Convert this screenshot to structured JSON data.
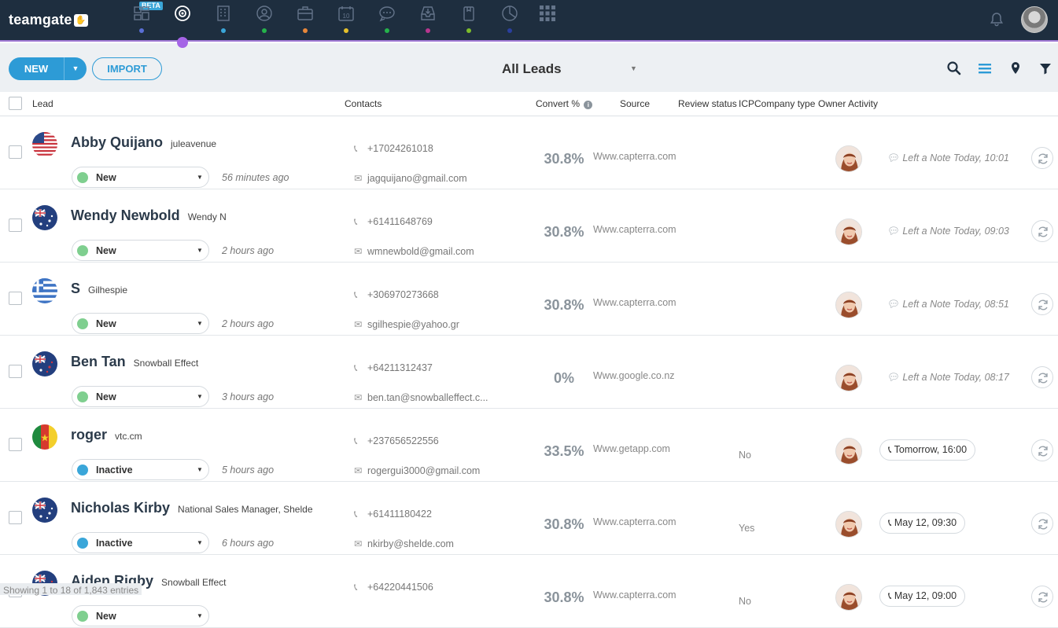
{
  "app": {
    "logo_text": "teamgate",
    "beta_label": "BETA",
    "nav_icons": [
      {
        "name": "dashboard-icon",
        "dot": "#5a6fd6"
      },
      {
        "name": "target-icon",
        "dot": ""
      },
      {
        "name": "building-icon",
        "dot": "#3aa6d9"
      },
      {
        "name": "contacts-icon",
        "dot": "#25b34b"
      },
      {
        "name": "briefcase-icon",
        "dot": "#e8873a"
      },
      {
        "name": "calendar-icon",
        "dot": "#e6c02b"
      },
      {
        "name": "chat-icon",
        "dot": "#25b34b"
      },
      {
        "name": "inbox-icon",
        "dot": "#b8368f"
      },
      {
        "name": "clipboard-icon",
        "dot": "#7dbd2b"
      },
      {
        "name": "pie-chart-icon",
        "dot": "#2a3f9e"
      },
      {
        "name": "apps-grid-icon",
        "dot": ""
      }
    ]
  },
  "toolbar": {
    "new_label": "NEW",
    "import_label": "IMPORT",
    "view_label": "All Leads"
  },
  "columns": {
    "lead": "Lead",
    "contacts": "Contacts",
    "convert": "Convert %",
    "source": "Source",
    "review_status": "Review status",
    "icp": "ICP",
    "company_type": "Company type",
    "owner": "Owner",
    "activity": "Activity"
  },
  "rows": [
    {
      "name": "Abby Quijano",
      "company": "juleavenue",
      "flag": "us",
      "status": "New",
      "status_color": "#7fcf8f",
      "time": "56 minutes ago",
      "phone": "+17024261018",
      "email": "jagquijano@gmail.com",
      "convert": "30.8%",
      "source": "Www.capterra.com",
      "icp": "",
      "activity_type": "note",
      "activity": "Left a Note Today, 10:01"
    },
    {
      "name": "Wendy Newbold",
      "company": "Wendy N",
      "flag": "au",
      "status": "New",
      "status_color": "#7fcf8f",
      "time": "2 hours ago",
      "phone": "+61411648769",
      "email": "wmnewbold@gmail.com",
      "convert": "30.8%",
      "source": "Www.capterra.com",
      "icp": "",
      "activity_type": "note",
      "activity": "Left a Note Today, 09:03"
    },
    {
      "name": "S",
      "company": "Gilhespie",
      "flag": "gr",
      "status": "New",
      "status_color": "#7fcf8f",
      "time": "2 hours ago",
      "phone": "+306970273668",
      "email": "sgilhespie@yahoo.gr",
      "convert": "30.8%",
      "source": "Www.capterra.com",
      "icp": "",
      "activity_type": "note",
      "activity": "Left a Note Today, 08:51"
    },
    {
      "name": "Ben Tan",
      "company": "Snowball Effect",
      "flag": "nz",
      "status": "New",
      "status_color": "#7fcf8f",
      "time": "3 hours ago",
      "phone": "+64211312437",
      "email": "ben.tan@snowballeffect.c...",
      "convert": "0%",
      "source": "Www.google.co.nz",
      "icp": "",
      "activity_type": "note",
      "activity": "Left a Note Today, 08:17"
    },
    {
      "name": "roger",
      "company": "vtc.cm",
      "flag": "cm",
      "status": "Inactive",
      "status_color": "#3aa6d9",
      "time": "5 hours ago",
      "phone": "+237656522556",
      "email": "rogergui3000@gmail.com",
      "convert": "33.5%",
      "source": "Www.getapp.com",
      "icp": "No",
      "activity_type": "call",
      "activity": "Tomorrow, 16:00"
    },
    {
      "name": "Nicholas Kirby",
      "company": "National Sales Manager, Shelde",
      "flag": "au",
      "status": "Inactive",
      "status_color": "#3aa6d9",
      "time": "6 hours ago",
      "phone": "+61411180422",
      "email": "nkirby@shelde.com",
      "convert": "30.8%",
      "source": "Www.capterra.com",
      "icp": "Yes",
      "activity_type": "call",
      "activity": "May 12, 09:30"
    },
    {
      "name": "Aiden Rigby",
      "company": "Snowball Effect",
      "flag": "nz",
      "status": "New",
      "status_color": "#7fcf8f",
      "time": "",
      "phone": "+64220441506",
      "email": "",
      "convert": "30.8%",
      "source": "Www.capterra.com",
      "icp": "No",
      "activity_type": "call",
      "activity": "May 12, 09:00"
    }
  ],
  "footer": {
    "showing": "Showing 1 to 18 of 1,843 entries"
  }
}
